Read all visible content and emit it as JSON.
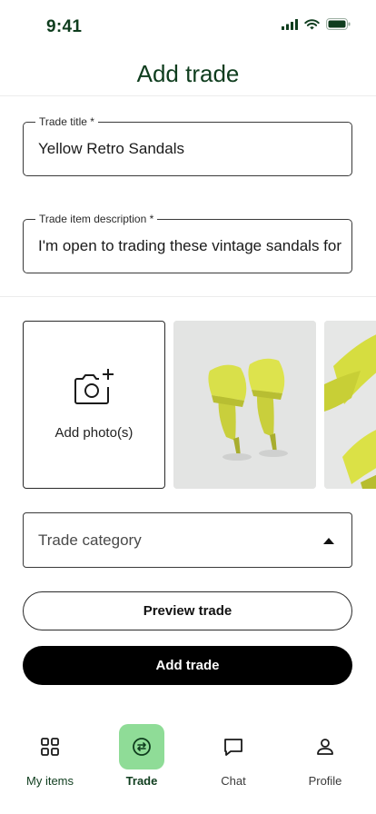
{
  "status_bar": {
    "time": "9:41"
  },
  "header": {
    "title": "Add trade"
  },
  "form": {
    "title_field": {
      "label": "Trade title *",
      "value": "Yellow Retro Sandals"
    },
    "description_field": {
      "label": "Trade item description *",
      "value": "I'm open to trading these vintage sandals for"
    },
    "photos": {
      "add_label": "Add photo(s)"
    },
    "category": {
      "placeholder": "Trade category"
    }
  },
  "actions": {
    "preview_label": "Preview trade",
    "add_label": "Add trade"
  },
  "nav": {
    "items": [
      {
        "label": "My items",
        "icon": "grid-icon"
      },
      {
        "label": "Trade",
        "icon": "trade-icon",
        "active": true
      },
      {
        "label": "Chat",
        "icon": "chat-icon"
      },
      {
        "label": "Profile",
        "icon": "profile-icon"
      }
    ]
  },
  "colors": {
    "brand_dark_green": "#0f3d1e",
    "active_nav_bg": "#8fdc97",
    "sandal_yellow": "#d7e046"
  }
}
